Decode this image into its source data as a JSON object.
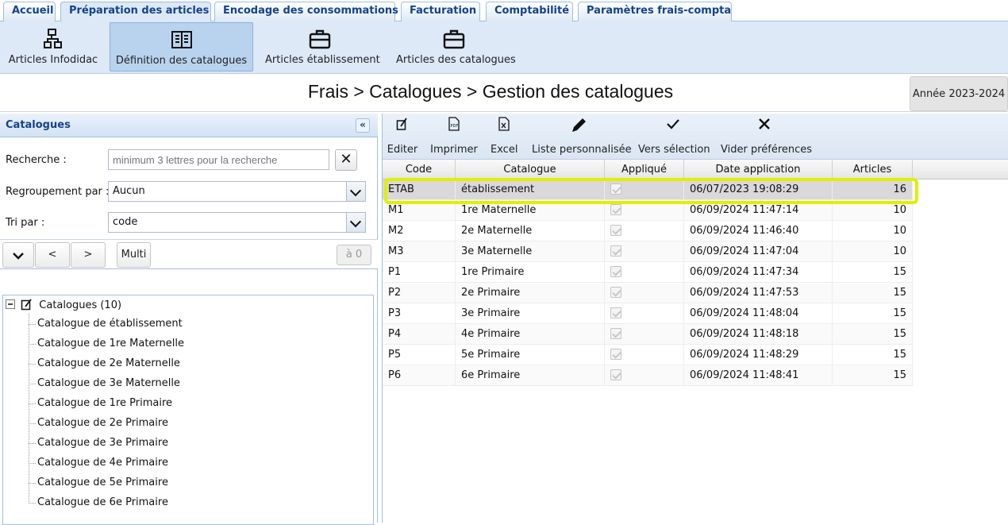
{
  "tabs": [
    {
      "label": "Accueil"
    },
    {
      "label": "Préparation des articles"
    },
    {
      "label": "Encodage des consommations"
    },
    {
      "label": "Facturation"
    },
    {
      "label": "Comptabilité"
    },
    {
      "label": "Paramètres frais-compta"
    }
  ],
  "ribbon": {
    "items": [
      {
        "label": "Articles Infodidac",
        "icon": "network-icon"
      },
      {
        "label": "Définition des catalogues",
        "icon": "book-icon"
      },
      {
        "label": "Articles établissement",
        "icon": "briefcase-icon"
      },
      {
        "label": "Articles des catalogues",
        "icon": "briefcase-icon"
      }
    ]
  },
  "breadcrumb": "Frais > Catalogues > Gestion des catalogues",
  "year_button": "Année 2023-2024",
  "left_panel": {
    "title": "Catalogues",
    "search": {
      "label": "Recherche :",
      "placeholder": "minimum 3 lettres pour la recherche",
      "value": ""
    },
    "grouping": {
      "label": "Regroupement par :",
      "value": "Aucun"
    },
    "sort": {
      "label": "Tri par :",
      "value": "code"
    },
    "nav": {
      "prev": "<",
      "next": ">",
      "multi": "Multi",
      "reset": "à 0"
    },
    "tree": {
      "root": "Catalogues (10)",
      "items": [
        "Catalogue de établissement",
        "Catalogue de 1re Maternelle",
        "Catalogue de 2e Maternelle",
        "Catalogue de 3e Maternelle",
        "Catalogue de 1re Primaire",
        "Catalogue de 2e Primaire",
        "Catalogue de 3e Primaire",
        "Catalogue de 4e Primaire",
        "Catalogue de 5e Primaire",
        "Catalogue de 6e Primaire"
      ]
    }
  },
  "toolbar": {
    "items": [
      {
        "label": "Editer",
        "icon": "edit-icon"
      },
      {
        "label": "Imprimer",
        "icon": "print-icon"
      },
      {
        "label": "Excel",
        "icon": "excel-icon"
      },
      {
        "label": "Liste personnalisée",
        "icon": "pencil-icon"
      },
      {
        "label": "Vers sélection",
        "icon": "checkmark-icon"
      },
      {
        "label": "Vider préférences",
        "icon": "clear-icon"
      }
    ]
  },
  "grid": {
    "columns": [
      "Code",
      "Catalogue",
      "Appliqué",
      "Date application",
      "Articles"
    ],
    "rows": [
      {
        "code": "ETAB",
        "catalogue": "établissement",
        "applied": true,
        "date": "06/07/2023 19:08:29",
        "articles": "16"
      },
      {
        "code": "M1",
        "catalogue": "1re Maternelle",
        "applied": true,
        "date": "06/09/2024 11:47:14",
        "articles": "10"
      },
      {
        "code": "M2",
        "catalogue": "2e Maternelle",
        "applied": true,
        "date": "06/09/2024 11:46:40",
        "articles": "10"
      },
      {
        "code": "M3",
        "catalogue": "3e Maternelle",
        "applied": true,
        "date": "06/09/2024 11:47:04",
        "articles": "10"
      },
      {
        "code": "P1",
        "catalogue": "1re Primaire",
        "applied": true,
        "date": "06/09/2024 11:47:34",
        "articles": "15"
      },
      {
        "code": "P2",
        "catalogue": "2e Primaire",
        "applied": true,
        "date": "06/09/2024 11:47:53",
        "articles": "15"
      },
      {
        "code": "P3",
        "catalogue": "3e Primaire",
        "applied": true,
        "date": "06/09/2024 11:48:04",
        "articles": "15"
      },
      {
        "code": "P4",
        "catalogue": "4e Primaire",
        "applied": true,
        "date": "06/09/2024 11:48:18",
        "articles": "15"
      },
      {
        "code": "P5",
        "catalogue": "5e Primaire",
        "applied": true,
        "date": "06/09/2024 11:48:29",
        "articles": "15"
      },
      {
        "code": "P6",
        "catalogue": "6e Primaire",
        "applied": true,
        "date": "06/09/2024 11:48:41",
        "articles": "15"
      }
    ],
    "selected_row": 0
  },
  "colors": {
    "highlight": "#dff000",
    "header_text": "#15428b",
    "ribbon_bg": "#dde9f7"
  }
}
